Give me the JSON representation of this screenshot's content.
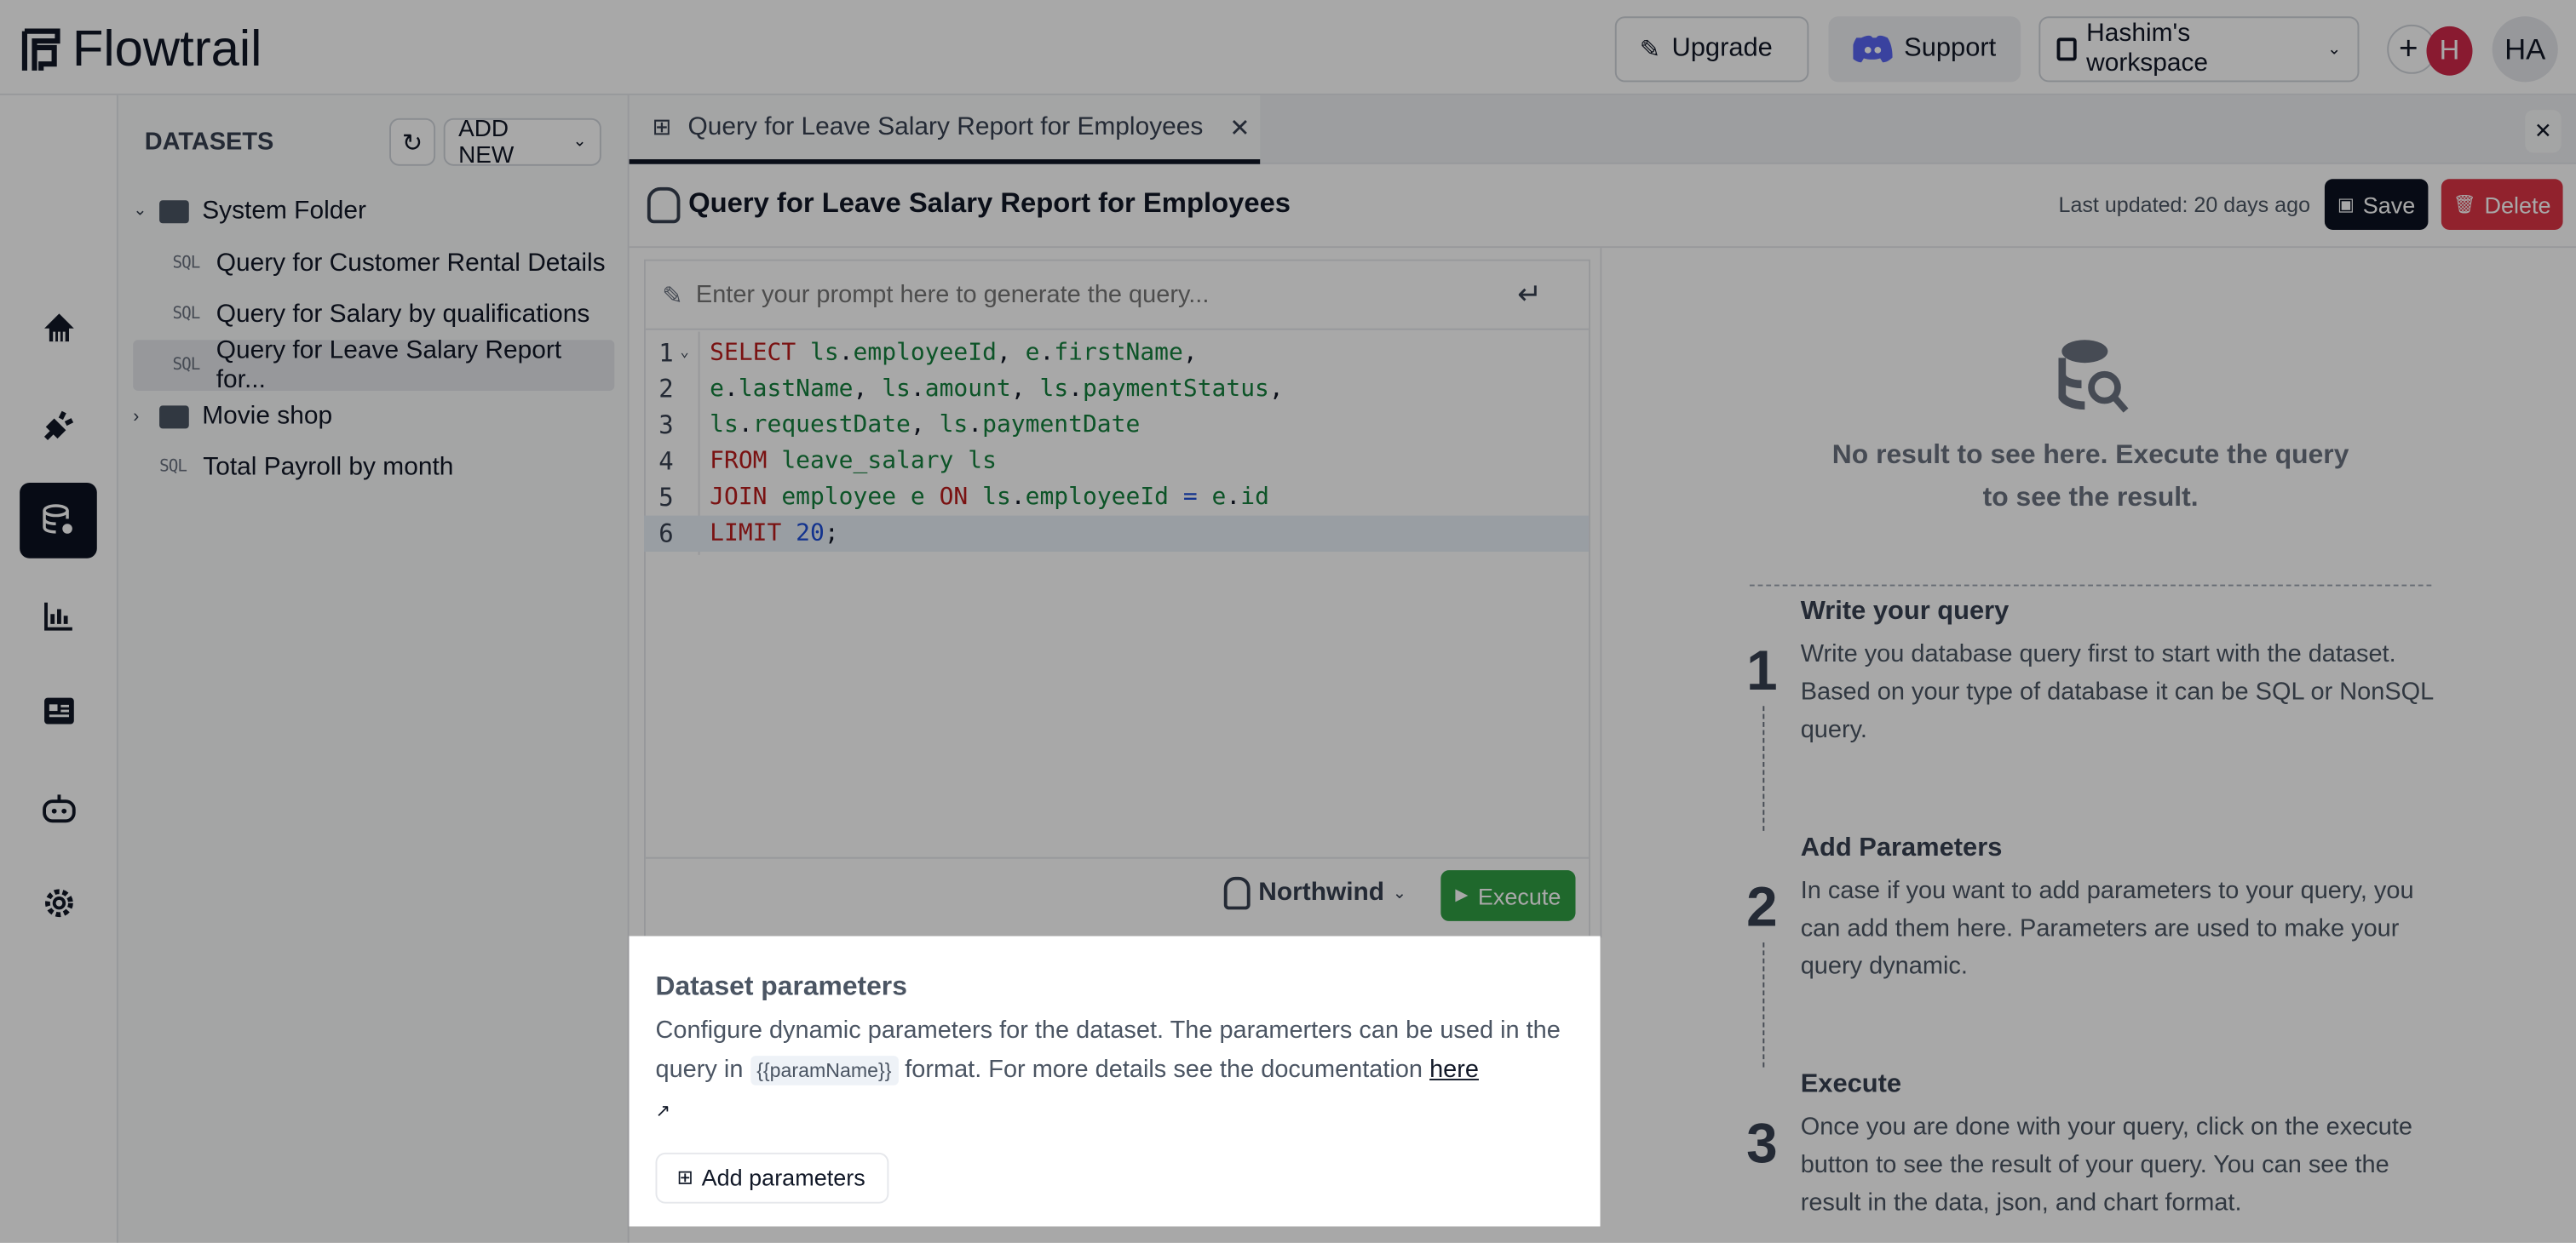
{
  "header": {
    "brand": "Flowtrail",
    "upgrade_label": "Upgrade",
    "support_label": "Support",
    "workspace_label": "Hashim's workspace",
    "add_member_label": "+",
    "member_avatar": "H",
    "user_avatar": "HA"
  },
  "sidebar_rail": {
    "items": [
      "home-icon",
      "plug-icon",
      "dataset-icon",
      "chart-icon",
      "dashboard-icon",
      "bot-icon",
      "gear-icon"
    ],
    "active": "dataset-icon"
  },
  "datasets_panel": {
    "title": "DATASETS",
    "add_new_label": "ADD NEW",
    "tree": [
      {
        "type": "folder",
        "label": "System Folder",
        "expanded": true
      },
      {
        "type": "sql",
        "badge": "SQL",
        "label": "Query for Customer Rental Details"
      },
      {
        "type": "sql",
        "badge": "SQL",
        "label": "Query for Salary by qualifications"
      },
      {
        "type": "sql",
        "badge": "SQL",
        "label": "Query for Leave Salary Report for...",
        "selected": true
      },
      {
        "type": "folder",
        "label": "Movie shop",
        "expanded": false
      },
      {
        "type": "sql",
        "badge": "SQL",
        "label": "Total Payroll by month"
      }
    ]
  },
  "tabs": [
    {
      "label": "Query for Leave Salary Report for Employees",
      "active": true
    }
  ],
  "query": {
    "title": "Query for Leave Salary Report for Employees",
    "last_updated": "Last updated: 20 days ago",
    "save_label": "Save",
    "delete_label": "Delete",
    "prompt_placeholder": "Enter your prompt here to generate the query...",
    "code_lines": [
      "SELECT ls.employeeId, e.firstName,",
      "e.lastName, ls.amount, ls.paymentStatus,",
      "ls.requestDate, ls.paymentDate",
      "FROM leave_salary ls",
      "JOIN employee e ON ls.employeeId = e.id",
      "LIMIT 20;"
    ],
    "line_numbers": [
      "1",
      "2",
      "3",
      "4",
      "5",
      "6"
    ],
    "datasource": "Northwind",
    "execute_label": "Execute"
  },
  "parameters": {
    "title": "Dataset parameters",
    "desc_1": "Configure dynamic parameters for the dataset. The paramerters can be used in the query in",
    "code": "{{paramName}}",
    "desc_2": "format. For more details see the documentation",
    "link": "here",
    "add_label": "Add parameters"
  },
  "result": {
    "empty_line1": "No result to see here. Execute the query",
    "empty_line2": "to see the result.",
    "steps": [
      {
        "num": "1",
        "title": "Write your query",
        "text": "Write you database query first to start with the dataset. Based on your type of database it can be SQL or NonSQL query."
      },
      {
        "num": "2",
        "title": "Add Parameters",
        "text": "In case if you want to add parameters to your query, you can add them here. Parameters are used to make your query dynamic."
      },
      {
        "num": "3",
        "title": "Execute",
        "text": "Once you are done with your query, click on the execute button to see the result of your query. You can see the result in the data, json, and chart format."
      }
    ]
  },
  "colors": {
    "save": "#0b1220",
    "delete": "#dc3545",
    "execute": "#2f9e44",
    "discord": "#5865f2",
    "avatar_h": "#d0284a",
    "overlay": "rgba(0,0,0,0.34)"
  }
}
